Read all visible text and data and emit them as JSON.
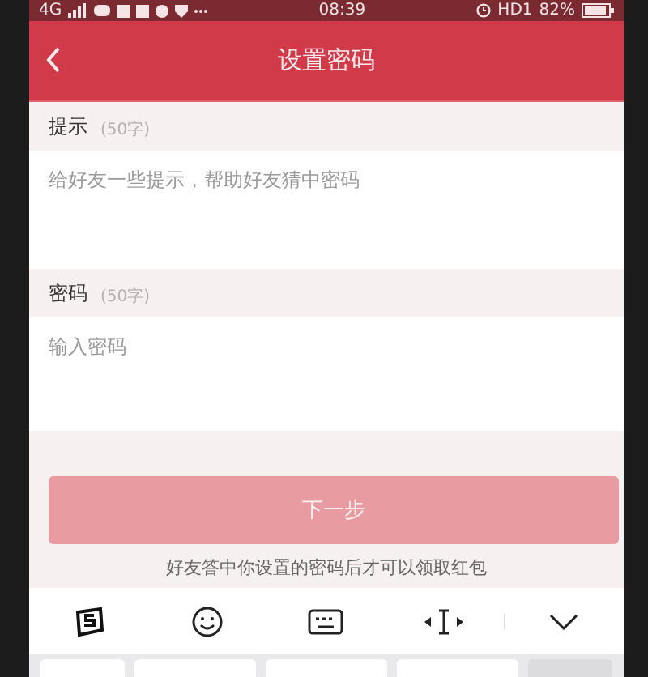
{
  "status_bar": {
    "network": "4G",
    "time": "08:39",
    "hd": "HD1",
    "battery": "82%"
  },
  "header": {
    "title": "设置密码"
  },
  "sections": [
    {
      "label": "提示",
      "limit": "(50字)",
      "placeholder": "给好友一些提示，帮助好友猜中密码"
    },
    {
      "label": "密码",
      "limit": "(50字)",
      "placeholder": "输入密码"
    }
  ],
  "button": {
    "label": "下一步",
    "disabled": true
  },
  "note": "好友答中你设置的密码后才可以领取红包"
}
